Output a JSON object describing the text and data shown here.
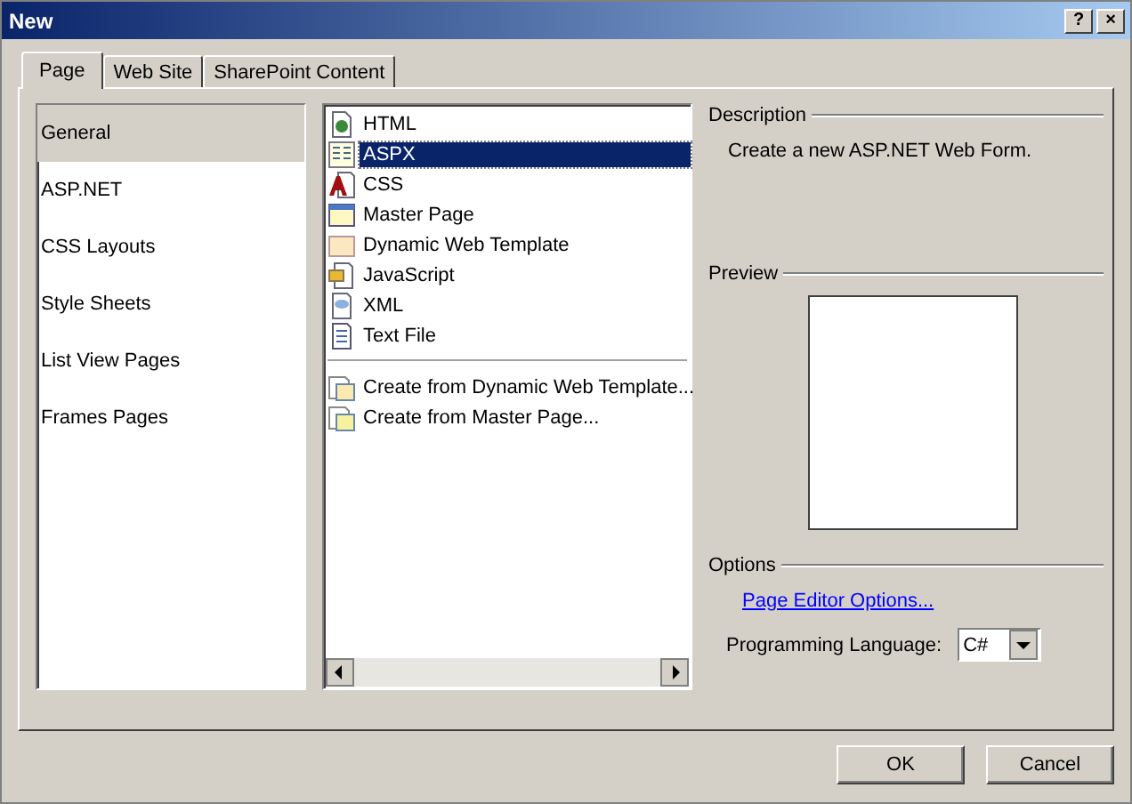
{
  "window": {
    "title": "New"
  },
  "title_buttons": [
    "?",
    "×"
  ],
  "tabs": [
    {
      "label": "Page",
      "selected": true
    },
    {
      "label": "Web Site",
      "selected": false
    },
    {
      "label": "SharePoint Content",
      "selected": false
    }
  ],
  "categories": [
    {
      "label": "General",
      "selected": true
    },
    {
      "label": "ASP.NET",
      "selected": false
    },
    {
      "label": "CSS Layouts",
      "selected": false
    },
    {
      "label": "Style Sheets",
      "selected": false
    },
    {
      "label": "List View Pages",
      "selected": false
    },
    {
      "label": "Frames Pages",
      "selected": false
    }
  ],
  "templates": [
    {
      "label": "HTML",
      "kind": "html",
      "selected": false
    },
    {
      "label": "ASPX",
      "kind": "aspx",
      "selected": true
    },
    {
      "label": "CSS",
      "kind": "css",
      "selected": false
    },
    {
      "label": "Master Page",
      "kind": "master",
      "selected": false
    },
    {
      "label": "Dynamic Web Template",
      "kind": "dwt",
      "selected": false
    },
    {
      "label": "JavaScript",
      "kind": "js",
      "selected": false
    },
    {
      "label": "XML",
      "kind": "xml",
      "selected": false
    },
    {
      "label": "Text File",
      "kind": "text",
      "selected": false
    }
  ],
  "create_from": [
    {
      "label": "Create from Dynamic Web Template...",
      "kind": "from-dwt",
      "selected": false
    },
    {
      "label": "Create from Master Page...",
      "kind": "from-master",
      "selected": false
    }
  ],
  "description": {
    "heading": "Description",
    "text": "Create a new ASP.NET Web Form."
  },
  "preview": {
    "heading": "Preview"
  },
  "options": {
    "heading": "Options",
    "link": "Page Editor Options...",
    "language_label": "Programming Language:",
    "language_value": "C#"
  },
  "buttons": [
    "OK",
    "Cancel"
  ]
}
